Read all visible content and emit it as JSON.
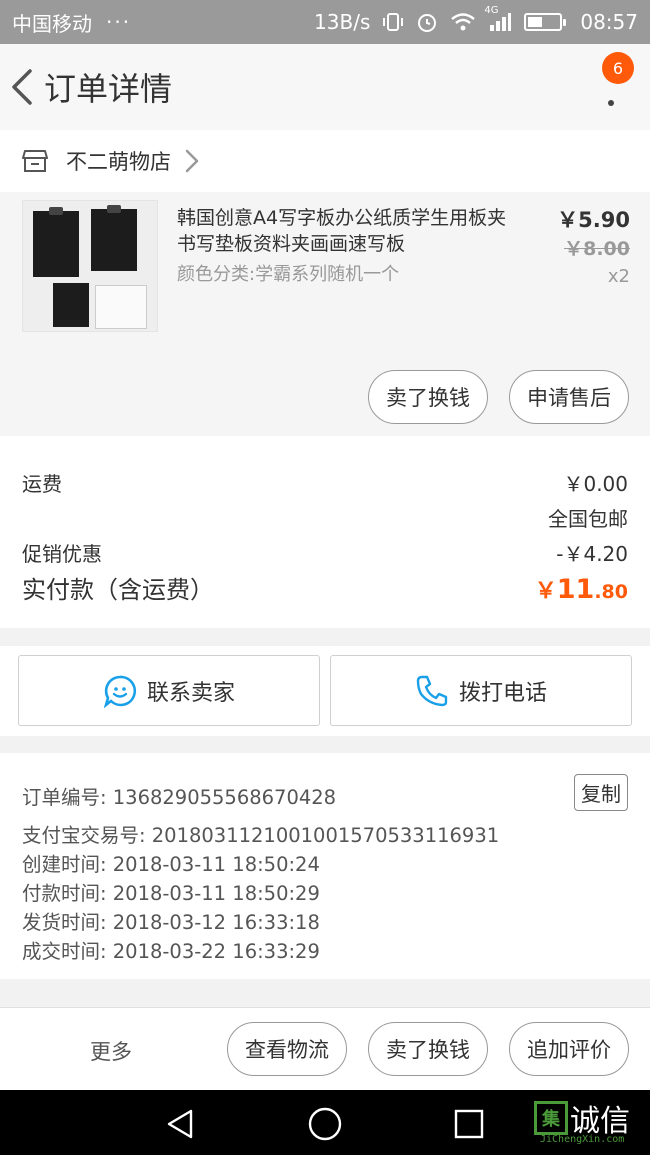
{
  "status_bar": {
    "carrier": "中国移动",
    "dots": "···",
    "speed": "13B/s",
    "network": "4G",
    "time": "08:57"
  },
  "header": {
    "title": "订单详情",
    "badge": "6"
  },
  "shop": {
    "name": "不二萌物店"
  },
  "product": {
    "name": "韩国创意A4写字板办公纸质学生用板夹书写垫板资料夹画画速写板",
    "spec": "颜色分类:学霸系列随机一个",
    "price": "￥5.90",
    "original_price": "￥8.00",
    "quantity": "x2",
    "sell_label": "卖了换钱",
    "after_sale_label": "申请售后"
  },
  "fees": {
    "shipping_label": "运费",
    "shipping_value": "￥0.00",
    "shipping_note": "全国包邮",
    "promo_label": "促销优惠",
    "promo_value": "-￥4.20",
    "total_label": "实付款（含运费）",
    "total_symbol": "￥",
    "total_int": "11",
    "total_dec": ".80"
  },
  "contact": {
    "seller_label": "联系卖家",
    "phone_label": "拨打电话"
  },
  "order_info": {
    "order_no": "订单编号: 136829055568670428",
    "copy_label": "复制",
    "alipay_no": "支付宝交易号: 2018031121001001570533116931",
    "created": "创建时间: 2018-03-11 18:50:24",
    "paid": "付款时间: 2018-03-11 18:50:29",
    "shipped": "发货时间: 2018-03-12 16:33:18",
    "completed": "成交时间: 2018-03-22 16:33:29"
  },
  "actions": {
    "more_label": "更多",
    "logistics_label": "查看物流",
    "sell_label": "卖了换钱",
    "review_label": "追加评价"
  },
  "watermark": {
    "char": "集",
    "text": "诚信",
    "sub": "JiChengXin.com"
  },
  "colors": {
    "accent": "#ff5a0a",
    "contact_icon": "#1aa0e8"
  }
}
